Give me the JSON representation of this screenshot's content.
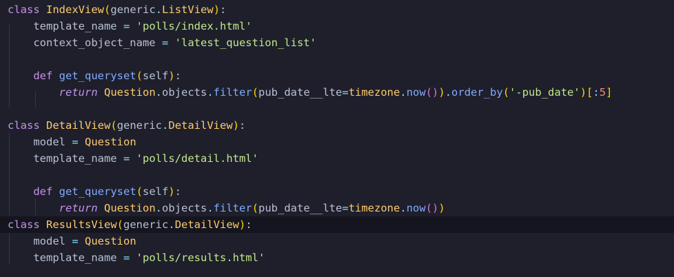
{
  "editor": {
    "language": "python",
    "current_line": 14,
    "lines": [
      [
        [
          "kw",
          "class"
        ],
        [
          "plain",
          " "
        ],
        [
          "cls",
          "IndexView"
        ],
        [
          "p1",
          "("
        ],
        [
          "plain",
          "generic"
        ],
        [
          "op",
          "."
        ],
        [
          "cls",
          "ListView"
        ],
        [
          "p1",
          ")"
        ],
        [
          "plain",
          ":"
        ]
      ],
      [
        [
          "plain",
          "    template_name "
        ],
        [
          "op",
          "="
        ],
        [
          "plain",
          " "
        ],
        [
          "str",
          "'polls/index.html'"
        ]
      ],
      [
        [
          "plain",
          "    context_object_name "
        ],
        [
          "op",
          "="
        ],
        [
          "plain",
          " "
        ],
        [
          "str",
          "'latest_question_list'"
        ]
      ],
      [],
      [
        [
          "plain",
          "    "
        ],
        [
          "kw",
          "def"
        ],
        [
          "plain",
          " "
        ],
        [
          "fn",
          "get_queryset"
        ],
        [
          "p1",
          "("
        ],
        [
          "self",
          "self"
        ],
        [
          "p1",
          ")"
        ],
        [
          "plain",
          ":"
        ]
      ],
      [
        [
          "plain",
          "        "
        ],
        [
          "kwi",
          "return"
        ],
        [
          "plain",
          " "
        ],
        [
          "cls",
          "Question"
        ],
        [
          "op",
          "."
        ],
        [
          "plain",
          "objects"
        ],
        [
          "op",
          "."
        ],
        [
          "fn",
          "filter"
        ],
        [
          "p1",
          "("
        ],
        [
          "plain",
          "pub_date__lte"
        ],
        [
          "op",
          "="
        ],
        [
          "cls",
          "timezone"
        ],
        [
          "op",
          "."
        ],
        [
          "fn",
          "now"
        ],
        [
          "p2",
          "()"
        ],
        [
          "p1",
          ")"
        ],
        [
          "op",
          "."
        ],
        [
          "fn",
          "order_by"
        ],
        [
          "p1",
          "("
        ],
        [
          "str",
          "'-pub_date'"
        ],
        [
          "p1",
          ")"
        ],
        [
          "p1",
          "["
        ],
        [
          "op",
          ":"
        ],
        [
          "num",
          "5"
        ],
        [
          "p1",
          "]"
        ]
      ],
      [],
      [
        [
          "kw",
          "class"
        ],
        [
          "plain",
          " "
        ],
        [
          "cls",
          "DetailView"
        ],
        [
          "p1",
          "("
        ],
        [
          "plain",
          "generic"
        ],
        [
          "op",
          "."
        ],
        [
          "cls",
          "DetailView"
        ],
        [
          "p1",
          ")"
        ],
        [
          "plain",
          ":"
        ]
      ],
      [
        [
          "plain",
          "    model "
        ],
        [
          "op",
          "="
        ],
        [
          "plain",
          " "
        ],
        [
          "cls",
          "Question"
        ]
      ],
      [
        [
          "plain",
          "    template_name "
        ],
        [
          "op",
          "="
        ],
        [
          "plain",
          " "
        ],
        [
          "str",
          "'polls/detail.html'"
        ]
      ],
      [],
      [
        [
          "plain",
          "    "
        ],
        [
          "kw",
          "def"
        ],
        [
          "plain",
          " "
        ],
        [
          "fn",
          "get_queryset"
        ],
        [
          "p1",
          "("
        ],
        [
          "self",
          "self"
        ],
        [
          "p1",
          ")"
        ],
        [
          "plain",
          ":"
        ]
      ],
      [
        [
          "plain",
          "        "
        ],
        [
          "kwi",
          "return"
        ],
        [
          "plain",
          " "
        ],
        [
          "cls",
          "Question"
        ],
        [
          "op",
          "."
        ],
        [
          "plain",
          "objects"
        ],
        [
          "op",
          "."
        ],
        [
          "fn",
          "filter"
        ],
        [
          "p1",
          "("
        ],
        [
          "plain",
          "pub_date__lte"
        ],
        [
          "op",
          "="
        ],
        [
          "cls",
          "timezone"
        ],
        [
          "op",
          "."
        ],
        [
          "fn",
          "now"
        ],
        [
          "p2",
          "()"
        ],
        [
          "p1",
          ")"
        ]
      ],
      [
        [
          "kw",
          "class"
        ],
        [
          "plain",
          " "
        ],
        [
          "cls",
          "ResultsView"
        ],
        [
          "p1",
          "("
        ],
        [
          "plain",
          "generic"
        ],
        [
          "op",
          "."
        ],
        [
          "cls",
          "DetailView"
        ],
        [
          "p1",
          ")"
        ],
        [
          "plain",
          ":"
        ]
      ],
      [
        [
          "plain",
          "    model "
        ],
        [
          "op",
          "="
        ],
        [
          "plain",
          " "
        ],
        [
          "cls",
          "Question"
        ]
      ],
      [
        [
          "plain",
          "    template_name "
        ],
        [
          "op",
          "="
        ],
        [
          "plain",
          " "
        ],
        [
          "str",
          "'polls/results.html'"
        ]
      ]
    ]
  }
}
